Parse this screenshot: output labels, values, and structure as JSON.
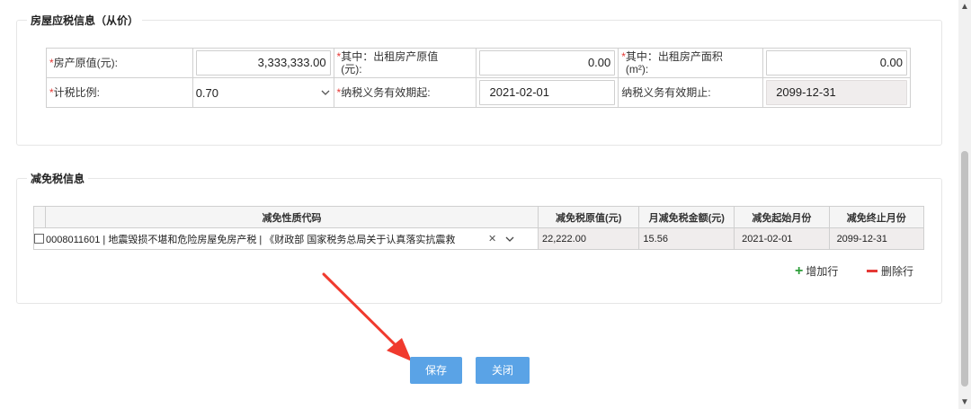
{
  "house_section": {
    "title": "房屋应税信息（从价）",
    "original_value_label": "房产原值(元):",
    "original_value": "3,333,333.00",
    "rented_value_label": "其中：出租房产原值(元):",
    "rented_value": "0.00",
    "rented_area_label": "其中：出租房产面积(m²):",
    "rented_area": "0.00",
    "tax_ratio_label": "计税比例:",
    "tax_ratio": "0.70",
    "valid_from_label": "纳税义务有效期起:",
    "valid_from": "2021-02-01",
    "valid_to_label": "纳税义务有效期止:",
    "valid_to": "2099-12-31"
  },
  "relief_section": {
    "title": "减免税信息",
    "columns": [
      "减免性质代码",
      "减免税原值(元)",
      "月减免税金额(元)",
      "减免起始月份",
      "减免终止月份"
    ],
    "rows": [
      {
        "code": "0008011601 | 地震毁损不堪和危险房屋免房产税 | 《财政部 国家税务总局关于认真落实抗震救",
        "original_value": "22,222.00",
        "monthly_amount": "15.56",
        "start_month": "2021-02-01",
        "end_month": "2099-12-31"
      }
    ],
    "add_row_label": "增加行",
    "delete_row_label": "删除行"
  },
  "actions": {
    "save_label": "保存",
    "close_label": "关闭"
  },
  "colors": {
    "primary_button": "#5aa3e6",
    "required_mark": "#e53935",
    "add_icon": "#2e9e3a",
    "annotation_arrow": "#f03a2e"
  },
  "icons": {
    "dropdown": "chevron-down-icon",
    "clear": "close-icon",
    "add": "plus-icon",
    "delete": "minus-icon",
    "arrow": "red-arrow-annotation"
  }
}
